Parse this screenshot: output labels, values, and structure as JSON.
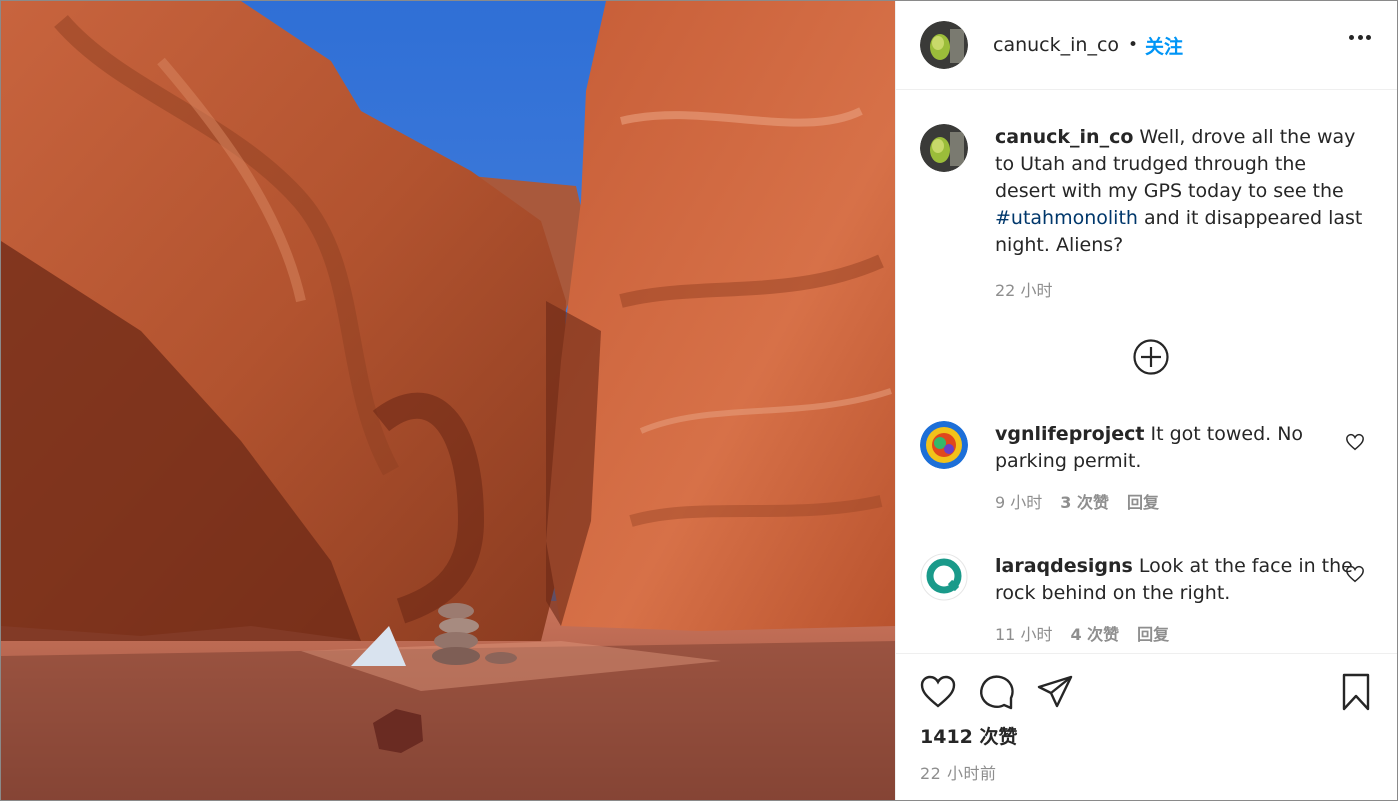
{
  "post": {
    "photo_alt": "Red sandstone canyon in the desert",
    "author": "canuck_in_co",
    "follow_label": "关注",
    "caption": {
      "username": "canuck_in_co",
      "text_before": " Well, drove all the way to Utah and trudged through the desert with my GPS today to see the ",
      "hashtag": "#utahmonolith",
      "text_after": " and it disappeared last night. Aliens?",
      "time": "22 小时"
    },
    "comments": [
      {
        "username": "vgnlifeproject",
        "text": " It got towed. No parking permit.",
        "time": "9 小时",
        "likes": "3 次赞",
        "reply": "回复"
      },
      {
        "username": "laraqdesigns",
        "text": " Look at the face in the rock behind on the right.",
        "time": "11 小时",
        "likes": "4 次赞",
        "reply": "回复"
      }
    ],
    "likes_count": "1412 次赞",
    "posted_ago": "22 小时前"
  },
  "icons": {
    "more": "more-horizontal-icon",
    "load_more": "plus-circle-icon",
    "like": "heart-icon",
    "comment": "comment-bubble-icon",
    "share": "paper-plane-icon",
    "save": "bookmark-icon"
  },
  "colors": {
    "accent": "#0095f6",
    "hashtag": "#00376b",
    "muted": "#8e8e8e",
    "text": "#262626"
  }
}
